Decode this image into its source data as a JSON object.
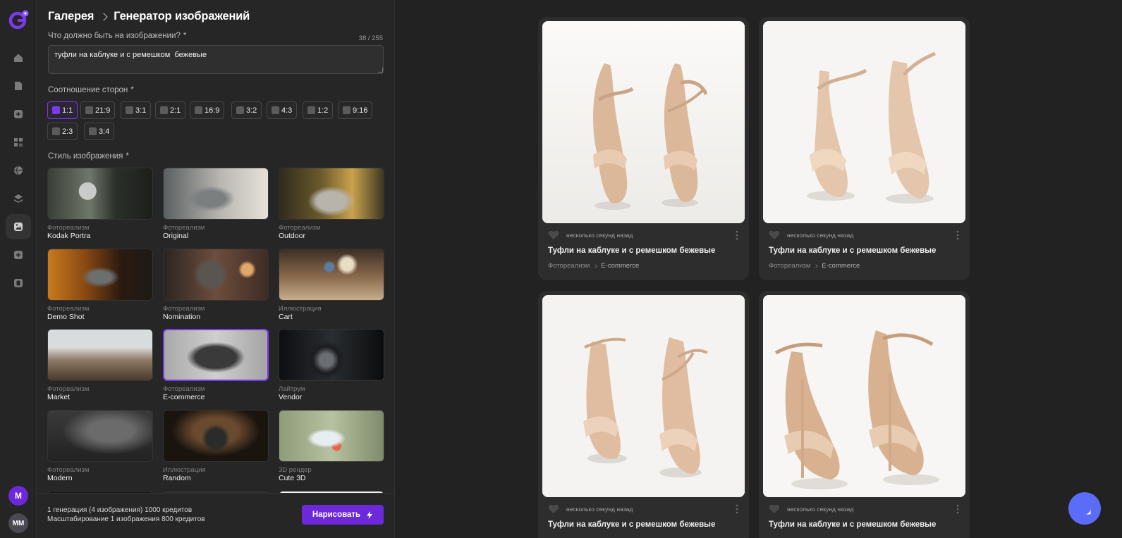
{
  "breadcrumb": {
    "root": "Галерея",
    "current": "Генератор изображений"
  },
  "prompt": {
    "label": "Что должно быть на изображении?",
    "required": "*",
    "value": "туфли на каблуке и с ремешком  бежевые",
    "counter": "38 / 255"
  },
  "aspect": {
    "label": "Соотношение сторон",
    "required": "*",
    "options": [
      "1:1",
      "21:9",
      "3:1",
      "2:1",
      "16:9",
      "3:2",
      "4:3",
      "1:2",
      "9:16",
      "2:3",
      "3:4"
    ],
    "selected": "1:1"
  },
  "style": {
    "label": "Стиль изображения",
    "required": "*",
    "items": [
      {
        "category": "Фотореализм",
        "name": "Kodak Portra"
      },
      {
        "category": "Фотореализм",
        "name": "Original"
      },
      {
        "category": "Фотореализм",
        "name": "Outdoor"
      },
      {
        "category": "Фотореализм",
        "name": "Demo Shot"
      },
      {
        "category": "Фотореализм",
        "name": "Nomination"
      },
      {
        "category": "Иллюстрация",
        "name": "Cart"
      },
      {
        "category": "Фотореализм",
        "name": "Market"
      },
      {
        "category": "Фотореализм",
        "name": "E-commerce"
      },
      {
        "category": "Лайтрум",
        "name": "Vendor"
      },
      {
        "category": "Фотореализм",
        "name": "Modern"
      },
      {
        "category": "Иллюстрация",
        "name": "Random"
      },
      {
        "category": "3D рендер",
        "name": "Cute 3D"
      }
    ],
    "selected": "E-commerce"
  },
  "footer": {
    "cost_line1": "1 генерация (4 изображения) 1000 кредитов",
    "cost_line2": "Масштабирование 1 изображения 800 кредитов",
    "draw_label": "Нарисовать"
  },
  "user": {
    "avatar1": "M",
    "avatar2": "MM"
  },
  "gallery": [
    {
      "time": "несколько секунд назад",
      "title": "Туфли на каблуке и с ремешком бежевые",
      "tag1": "Фотореализм",
      "tag2": "E-commerce"
    },
    {
      "time": "несколько секунд назад",
      "title": "Туфли на каблуке и с ремешком бежевые",
      "tag1": "Фотореализм",
      "tag2": "E-commerce"
    },
    {
      "time": "несколько секунд назад",
      "title": "Туфли на каблуке и с ремешком бежевые",
      "tag1": "",
      "tag2": ""
    },
    {
      "time": "несколько секунд назад",
      "title": "Туфли на каблуке и с ремешком бежевые",
      "tag1": "",
      "tag2": ""
    }
  ],
  "colors": {
    "accent": "#6d28d9",
    "chat": "#5b6cf8",
    "panel": "#262626",
    "background": "#222222"
  },
  "icons": [
    "home-icon",
    "document-icon",
    "plus-square-icon",
    "grid-icon",
    "basketball-icon",
    "layers-icon",
    "image-icon",
    "puzzle-icon",
    "database-icon",
    "heart-icon",
    "more-icon",
    "lightning-icon",
    "chat-icon"
  ]
}
